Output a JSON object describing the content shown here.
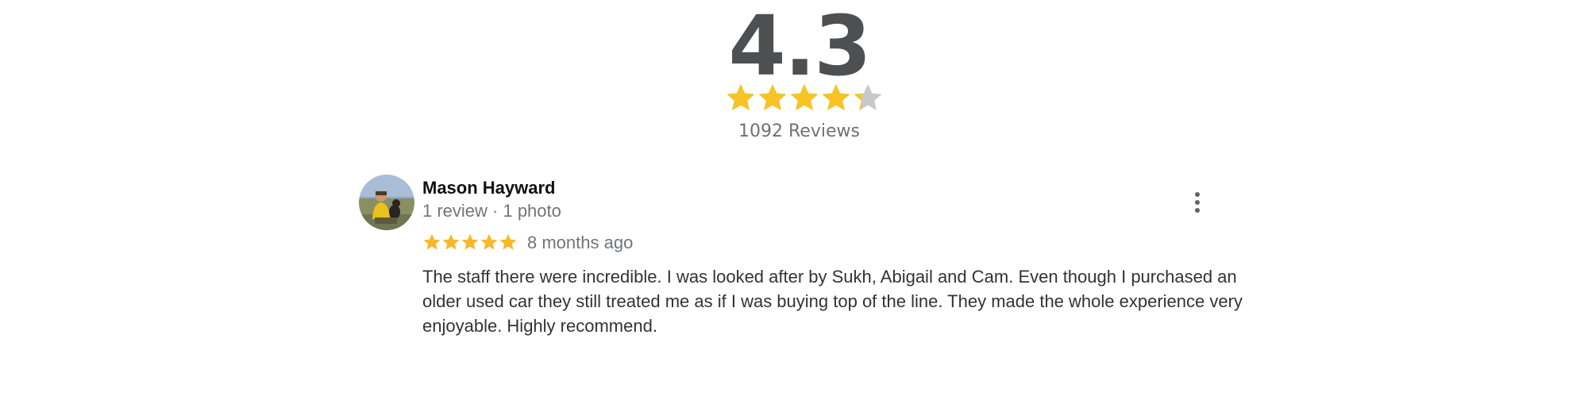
{
  "summary": {
    "rating": "4.3",
    "rating_value": 4.3,
    "max_rating": 5,
    "reviews_label": "1092 Reviews",
    "star_icon": "star-icon",
    "star_color": "#f7c325",
    "empty_star_color": "#c8c8c8"
  },
  "review": {
    "author": "Mason Hayward",
    "meta": "1 review · 1 photo",
    "rating_value": 5,
    "max_rating": 5,
    "time": "8 months ago",
    "text": "The staff there were incredible. I was looked after by Sukh, Abigail and Cam. Even though I purchased an older used car they still treated me as if I was buying top of the line. They made the whole experience very enjoyable. Highly recommend.",
    "avatar_icon": "avatar-icon",
    "more_icon": "more-vert-icon",
    "star_color": "#f7b92b"
  }
}
